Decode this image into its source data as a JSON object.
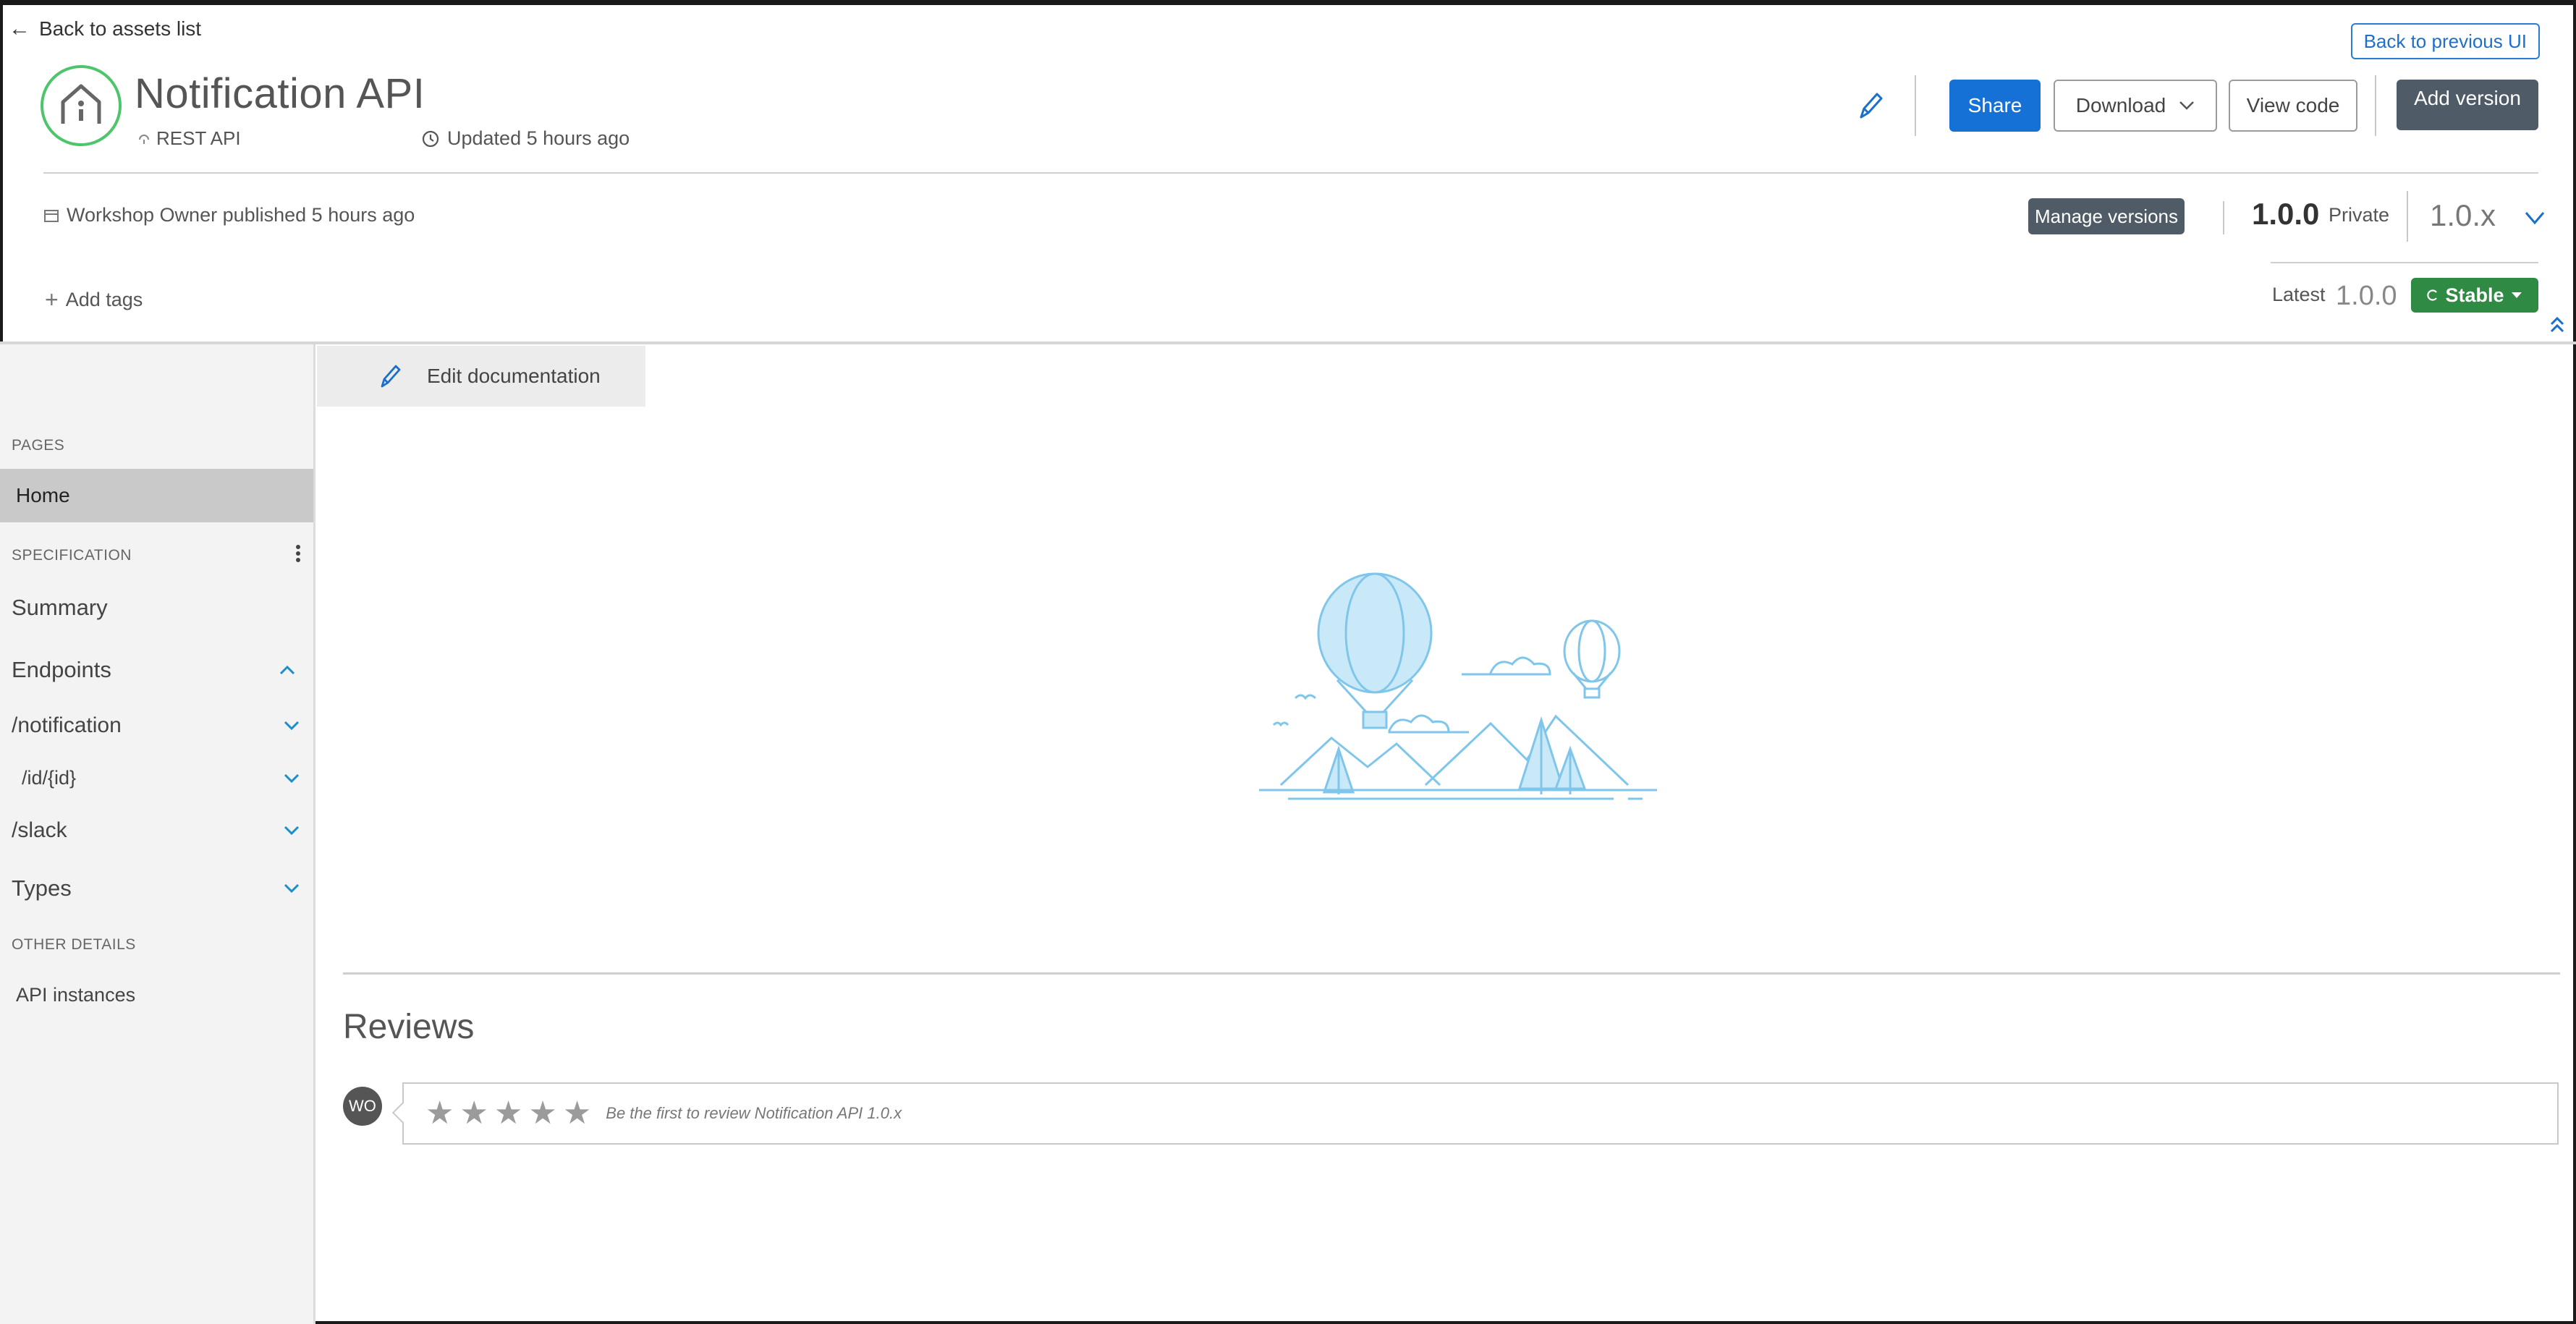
{
  "header": {
    "back_link": "Back to assets list",
    "back_previous_ui": "Back to previous UI",
    "asset_title": "Notification API",
    "asset_type": "REST API",
    "updated": "Updated 5 hours ago",
    "buttons": {
      "share": "Share",
      "download": "Download",
      "view_code": "View code",
      "add_version": "Add version"
    },
    "published_by": "Workshop Owner published 5 hours ago",
    "manage_versions": "Manage versions",
    "version": "1.0.0",
    "visibility": "Private",
    "version_group": "1.0.x",
    "add_tags": "Add tags",
    "latest_label": "Latest",
    "latest_version": "1.0.0",
    "lifecycle_state": "Stable"
  },
  "sidebar": {
    "pages_heading": "PAGES",
    "pages": [
      {
        "label": "Home"
      }
    ],
    "specification_heading": "SPECIFICATION",
    "spec_items": [
      {
        "label": "Summary"
      },
      {
        "label": "Endpoints"
      },
      {
        "label": "/notification"
      },
      {
        "label": "/id/{id}"
      },
      {
        "label": "/slack"
      },
      {
        "label": "Types"
      }
    ],
    "other_heading": "OTHER DETAILS",
    "other_items": [
      {
        "label": "API instances"
      }
    ]
  },
  "content": {
    "edit_documentation": "Edit documentation",
    "reviews_title": "Reviews",
    "reviewer_initials": "WO",
    "rating_stars": 0,
    "review_prompt": "Be the first to review Notification API 1.0.x"
  },
  "colors": {
    "primary_blue": "#1671d6",
    "dark_button": "#4f5b66",
    "stable_green": "#2f8a44",
    "logo_ring": "#4ec46b",
    "accent_chevron": "#1a8fc9"
  }
}
